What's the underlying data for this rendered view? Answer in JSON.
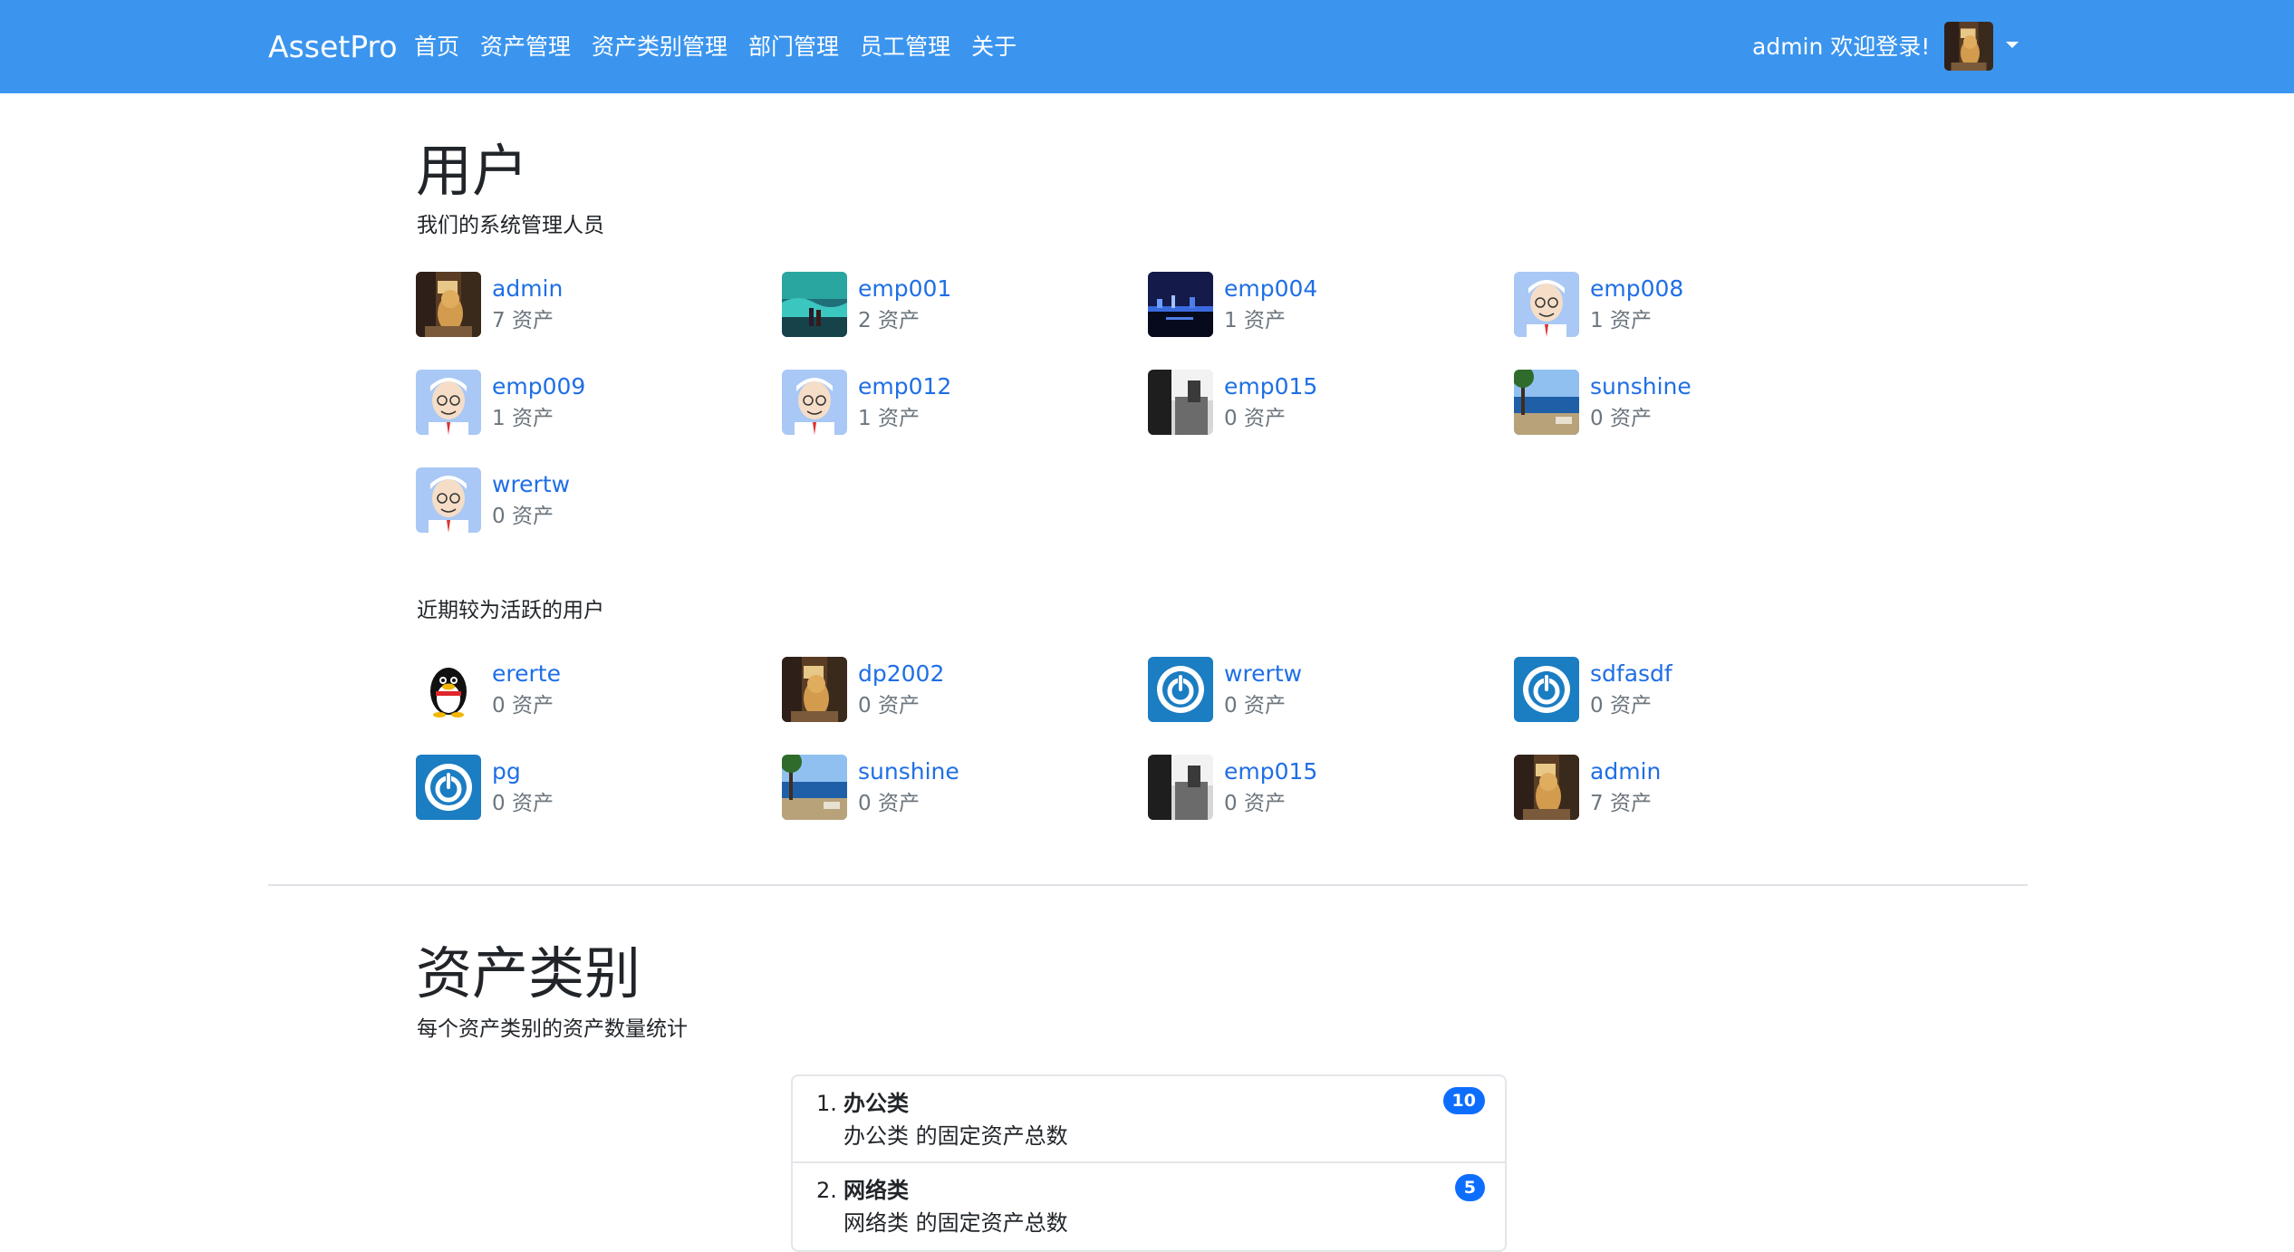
{
  "navbar": {
    "brand": "AssetPro",
    "links": [
      "首页",
      "资产管理",
      "资产类别管理",
      "部门管理",
      "员工管理",
      "关于"
    ],
    "welcome": "admin 欢迎登录!"
  },
  "users_section": {
    "title": "用户",
    "subtitle": "我们的系统管理人员",
    "users": [
      {
        "name": "admin",
        "count": "7 资产",
        "avatar": "cat-photo"
      },
      {
        "name": "emp001",
        "count": "2 资产",
        "avatar": "ocean-photo"
      },
      {
        "name": "emp004",
        "count": "1 资产",
        "avatar": "night-city-photo"
      },
      {
        "name": "emp008",
        "count": "1 资产",
        "avatar": "cartoon-man"
      },
      {
        "name": "emp009",
        "count": "1 资产",
        "avatar": "cartoon-man"
      },
      {
        "name": "emp012",
        "count": "1 资产",
        "avatar": "cartoon-man"
      },
      {
        "name": "emp015",
        "count": "0 资产",
        "avatar": "bw-photo"
      },
      {
        "name": "sunshine",
        "count": "0 资产",
        "avatar": "beach-photo"
      },
      {
        "name": "wrertw",
        "count": "0 资产",
        "avatar": "cartoon-man"
      }
    ]
  },
  "active_section": {
    "subtitle": "近期较为活跃的用户",
    "users": [
      {
        "name": "ererte",
        "count": "0 资产",
        "avatar": "penguin"
      },
      {
        "name": "dp2002",
        "count": "0 资产",
        "avatar": "cat-photo"
      },
      {
        "name": "wrertw",
        "count": "0 资产",
        "avatar": "power-icon"
      },
      {
        "name": "sdfasdf",
        "count": "0 资产",
        "avatar": "power-icon"
      },
      {
        "name": "pg",
        "count": "0 资产",
        "avatar": "power-icon"
      },
      {
        "name": "sunshine",
        "count": "0 资产",
        "avatar": "beach-photo"
      },
      {
        "name": "emp015",
        "count": "0 资产",
        "avatar": "bw-photo"
      },
      {
        "name": "admin",
        "count": "7 资产",
        "avatar": "cat-photo"
      }
    ]
  },
  "category_section": {
    "title": "资产类别",
    "subtitle": "每个资产类别的资产数量统计",
    "items": [
      {
        "num": "1.",
        "title": "办公类",
        "desc": "办公类 的固定资产总数",
        "badge": "10"
      },
      {
        "num": "2.",
        "title": "网络类",
        "desc": "网络类 的固定资产总数",
        "badge": "5"
      }
    ]
  },
  "colors": {
    "navbar": "#3b95ee",
    "link": "#1f6fe5",
    "badge": "#0d6efd",
    "muted": "#6c757d"
  }
}
